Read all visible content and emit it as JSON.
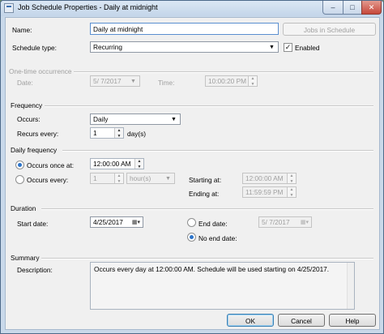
{
  "window": {
    "title": "Job Schedule Properties - Daily at midnight",
    "minimize_icon": "minimize-icon",
    "maximize_icon": "maximize-icon",
    "close_icon": "close-icon"
  },
  "name_row": {
    "label": "Name:",
    "value": "Daily at midnight",
    "jobs_button": "Jobs in Schedule"
  },
  "schedule_type": {
    "label": "Schedule type:",
    "value": "Recurring",
    "enabled_label": "Enabled",
    "enabled_checked": true
  },
  "one_time": {
    "section": "One-time occurrence",
    "date_label": "Date:",
    "date_value": "5/ 7/2017",
    "time_label": "Time:",
    "time_value": "10:00:20 PM"
  },
  "frequency": {
    "section": "Frequency",
    "occurs_label": "Occurs:",
    "occurs_value": "Daily",
    "recurs_label": "Recurs every:",
    "recurs_value": "1",
    "recurs_unit": "day(s)"
  },
  "daily_frequency": {
    "section": "Daily frequency",
    "once_label": "Occurs once at:",
    "once_value": "12:00:00 AM",
    "once_selected": true,
    "every_label": "Occurs every:",
    "every_value": "1",
    "every_unit": "hour(s)",
    "starting_label": "Starting at:",
    "starting_value": "12:00:00 AM",
    "ending_label": "Ending at:",
    "ending_value": "11:59:59 PM"
  },
  "duration": {
    "section": "Duration",
    "start_label": "Start date:",
    "start_value": "4/25/2017",
    "end_label": "End date:",
    "end_value": "5/ 7/2017",
    "no_end_label": "No end date:",
    "no_end_selected": true
  },
  "summary": {
    "section": "Summary",
    "desc_label": "Description:",
    "desc_value": "Occurs every day at 12:00:00 AM. Schedule will be used starting on 4/25/2017."
  },
  "buttons": {
    "ok": "OK",
    "cancel": "Cancel",
    "help": "Help"
  }
}
